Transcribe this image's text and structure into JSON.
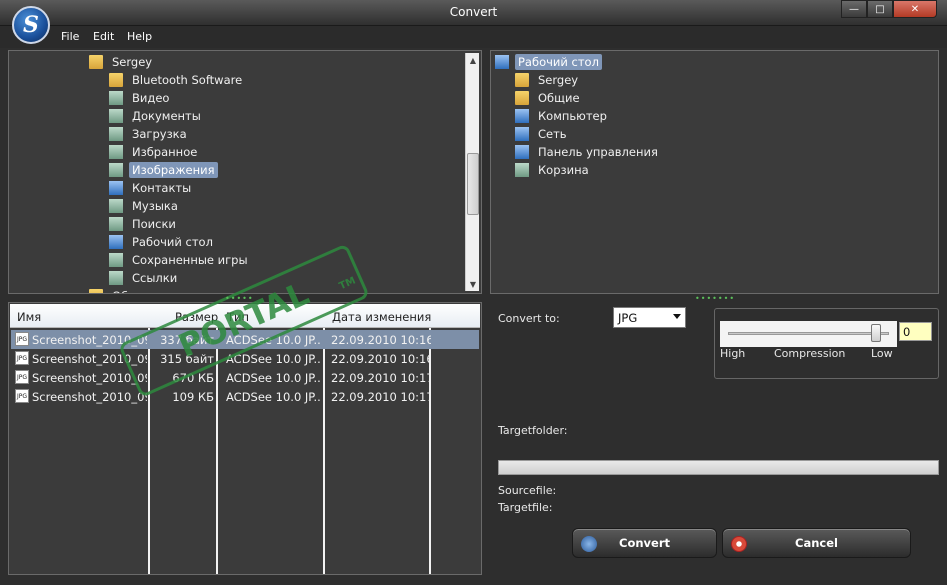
{
  "window": {
    "title": "Convert",
    "logo_letter": "S"
  },
  "menu": [
    "File",
    "Edit",
    "Help"
  ],
  "left_tree": {
    "items": [
      {
        "label": "Sergey",
        "icon": "folder-icon",
        "indent": 0
      },
      {
        "label": "Bluetooth Software",
        "icon": "folder-icon",
        "indent": 1
      },
      {
        "label": "Видео",
        "icon": "video-library-icon",
        "indent": 1
      },
      {
        "label": "Документы",
        "icon": "documents-library-icon",
        "indent": 1
      },
      {
        "label": "Загрузка",
        "icon": "downloads-icon",
        "indent": 1
      },
      {
        "label": "Избранное",
        "icon": "favorites-icon",
        "indent": 1
      },
      {
        "label": "Изображения",
        "icon": "pictures-library-icon",
        "indent": 1,
        "selected": true
      },
      {
        "label": "Контакты",
        "icon": "contacts-icon",
        "indent": 1
      },
      {
        "label": "Музыка",
        "icon": "music-library-icon",
        "indent": 1
      },
      {
        "label": "Поиски",
        "icon": "searches-icon",
        "indent": 1
      },
      {
        "label": "Рабочий стол",
        "icon": "desktop-folder-icon",
        "indent": 1
      },
      {
        "label": "Сохраненные игры",
        "icon": "saved-games-icon",
        "indent": 1
      },
      {
        "label": "Ссылки",
        "icon": "links-icon",
        "indent": 1
      },
      {
        "label": "Об",
        "icon": "folder-icon",
        "indent": 0
      }
    ]
  },
  "right_tree": {
    "root": "Рабочий стол",
    "items": [
      {
        "label": "Sergey",
        "icon": "user-folder-icon"
      },
      {
        "label": "Общие",
        "icon": "folder-icon"
      },
      {
        "label": "Компьютер",
        "icon": "computer-icon"
      },
      {
        "label": "Сеть",
        "icon": "network-icon"
      },
      {
        "label": "Панель управления",
        "icon": "control-panel-icon"
      },
      {
        "label": "Корзина",
        "icon": "recycle-bin-icon"
      }
    ]
  },
  "file_list": {
    "columns": [
      "Имя",
      "Размер",
      "Тип",
      "Дата изменения"
    ],
    "rows": [
      {
        "name": "Screenshot_2010_09...",
        "size": "337 байт",
        "type": "ACDSee 10.0 JP...",
        "date": "22.09.2010 10:16",
        "selected": true
      },
      {
        "name": "Screenshot_2010_09...",
        "size": "315 байт",
        "type": "ACDSee 10.0 JP...",
        "date": "22.09.2010 10:16"
      },
      {
        "name": "Screenshot_2010_09...",
        "size": "670 КБ",
        "type": "ACDSee 10.0 JP...",
        "date": "22.09.2010 10:17"
      },
      {
        "name": "Screenshot_2010_09...",
        "size": "109 КБ",
        "type": "ACDSee 10.0 JP...",
        "date": "22.09.2010 10:17"
      }
    ]
  },
  "options": {
    "convert_to_label": "Convert to:",
    "format": "JPG",
    "compression_high": "High",
    "compression_label": "Compression",
    "compression_low": "Low",
    "compression_value": "0",
    "slider_level": 0.95,
    "targetfolder_label": "Targetfolder:",
    "sourcefile_label": "Sourcefile:",
    "targetfile_label": "Targetfile:",
    "progress": 0
  },
  "buttons": {
    "convert": "Convert",
    "cancel": "Cancel"
  },
  "watermark": {
    "text": "PORTAL",
    "tm": "TM"
  }
}
